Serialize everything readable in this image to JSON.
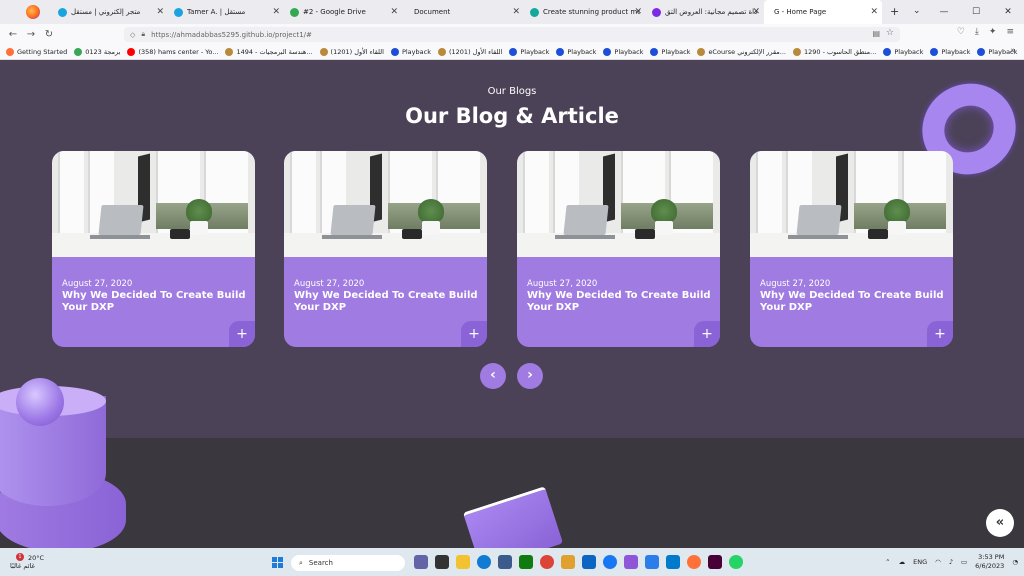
{
  "browser": {
    "tabs": [
      {
        "label": "متجر إلكتروني | مستقل",
        "color": "#1ba3e0",
        "active": false
      },
      {
        "label": "Tamer A. | مستقل",
        "color": "#1ba3e0",
        "active": false
      },
      {
        "label": "#2 - Google Drive",
        "color": "#34a853",
        "active": false
      },
      {
        "label": "Document",
        "color": "#ffffff",
        "active": false
      },
      {
        "label": "Create stunning product mock",
        "color": "#11a99a",
        "active": false
      },
      {
        "label": "أداة تصميم مجانية: العروض التق",
        "color": "#7d2ae8",
        "active": false
      },
      {
        "label": "G - Home Page",
        "color": "#ffffff",
        "active": true
      }
    ],
    "url": "https://ahmadabbas5295.github.io/project1/#",
    "bookmarks": [
      {
        "label": "Getting Started",
        "color": "#ff7139"
      },
      {
        "label": "برمجة 0123",
        "color": "#3aa757"
      },
      {
        "label": "(358) hams center - Yo...",
        "color": "#ff0000"
      },
      {
        "label": "هندسة البرمجيات - 1494...",
        "color": "#b88a3a"
      },
      {
        "label": "اللقاء الأول (1201)",
        "color": "#b88a3a"
      },
      {
        "label": "Playback",
        "color": "#1d4ed8"
      },
      {
        "label": "اللقاء الأول (1201)",
        "color": "#b88a3a"
      },
      {
        "label": "Playback",
        "color": "#1d4ed8"
      },
      {
        "label": "Playback",
        "color": "#1d4ed8"
      },
      {
        "label": "Playback",
        "color": "#1d4ed8"
      },
      {
        "label": "Playback",
        "color": "#1d4ed8"
      },
      {
        "label": "eCourse مقرر الإلكتروني...",
        "color": "#b88a3a"
      },
      {
        "label": "1290 - منطق الحاسوب...",
        "color": "#b88a3a"
      },
      {
        "label": "Playback",
        "color": "#1d4ed8"
      },
      {
        "label": "Playback",
        "color": "#1d4ed8"
      },
      {
        "label": "Playback",
        "color": "#1d4ed8"
      },
      {
        "label": "Playback",
        "color": "#1d4ed8"
      },
      {
        "label": "Playback",
        "color": "#1d4ed8"
      }
    ]
  },
  "section": {
    "subtitle": "Our Blogs",
    "title": "Our Blog & Article"
  },
  "cards": [
    {
      "date": "August 27, 2020",
      "title": "Why We Decided To Create Build Your DXP",
      "plus": "+"
    },
    {
      "date": "August 27, 2020",
      "title": "Why We Decided To Create Build Your DXP",
      "plus": "+"
    },
    {
      "date": "August 27, 2020",
      "title": "Why We Decided To Create Build Your DXP",
      "plus": "+"
    },
    {
      "date": "August 27, 2020",
      "title": "Why We Decided To Create Build Your DXP",
      "plus": "+"
    }
  ],
  "carousel": {
    "prev": "‹",
    "next": "›"
  },
  "back_to_top": "«",
  "colors": {
    "accent": "#9f7be2",
    "section_bg": "#4b4257",
    "footer_bg": "#3b373e"
  },
  "taskbar": {
    "weather_temp": "20°C",
    "weather_text": "غائم غالبًا",
    "weather_badge": "1",
    "search_label": "Search",
    "lang": "ENG",
    "time": "3:53 PM",
    "date": "6/6/2023"
  }
}
